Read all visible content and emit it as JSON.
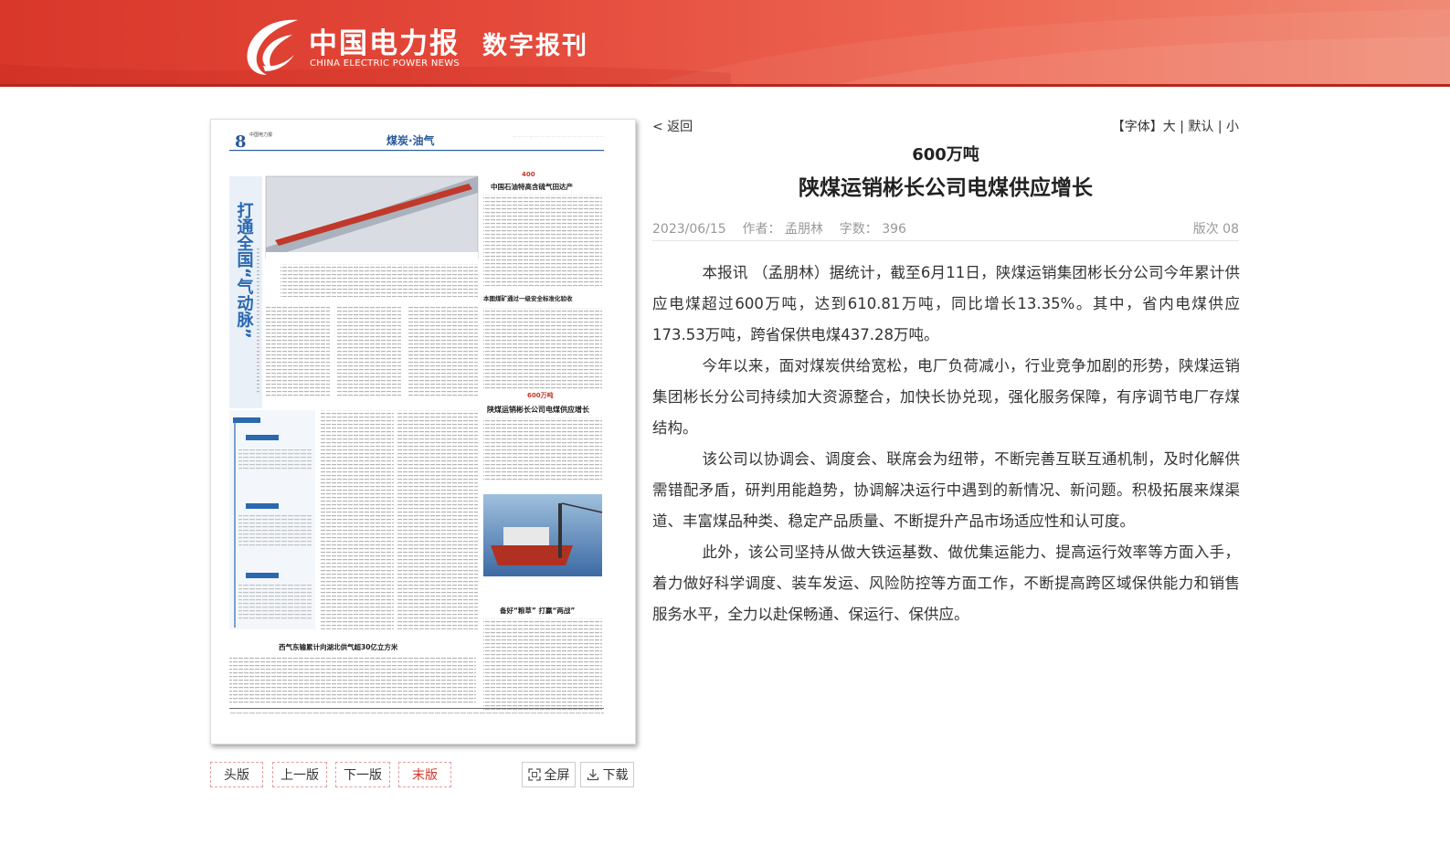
{
  "header": {
    "logo_cn": "中国电力报",
    "logo_en": "CHINA ELECTRIC POWER NEWS",
    "section": "数字报刊"
  },
  "paper_page": {
    "page_no": "8",
    "page_head": "中国电力报",
    "section_title": "煤炭·油气",
    "headline_vertical": "打通全国“气动脉”",
    "story_600_head": "600万吨",
    "story_600_title": "陕煤运销彬长公司电煤供应增长",
    "story_400_title": "中国石油特高含硫气田达产",
    "story_mine_title": "本图煤矿通过一级安全标准化验收",
    "story_gas_title": "西气东输累计向湖北供气超30亿立方米",
    "story_ship_title": "备好“粮草” 打赢“两战”"
  },
  "page_buttons": {
    "first": "头版",
    "prev": "上一版",
    "next": "下一版",
    "last": "末版",
    "fullscreen": "全屏",
    "download": "下载"
  },
  "nav": {
    "back": "< 返回",
    "font_label": "【字体】",
    "font_large": "大",
    "font_default": "默认",
    "font_small": "小"
  },
  "article": {
    "subtitle": "600万吨",
    "title": "陕煤运销彬长公司电煤供应增长",
    "date": "2023/06/15",
    "author_label": "作者：",
    "author": "孟朋林",
    "wordcount_label": "字数：",
    "wordcount": "396",
    "edition": "版次 08",
    "paragraphs": [
      "本报讯 （孟朋林）据统计，截至6月11日，陕煤运销集团彬长分公司今年累计供应电煤超过600万吨，达到610.81万吨，同比增长13.35%。其中，省内电煤供应173.53万吨，跨省保供电煤437.28万吨。",
      "今年以来，面对煤炭供给宽松，电厂负荷减小，行业竞争加剧的形势，陕煤运销集团彬长分公司持续加大资源整合，加快长协兑现，强化服务保障，有序调节电厂存煤结构。",
      "该公司以协调会、调度会、联席会为纽带，不断完善互联互通机制，及时化解供需错配矛盾，研判用能趋势，协调解决运行中遇到的新情况、新问题。积极拓展来煤渠道、丰富煤品种类、稳定产品质量、不断提升产品市场适应性和认可度。",
      "此外，该公司坚持从做大铁运基数、做优集运能力、提高运行效率等方面入手，着力做好科学调度、装车发运、风险防控等方面工作，不断提高跨区域保供能力和销售服务水平，全力以赴保畅通、保运行、保供应。"
    ]
  },
  "colors": {
    "brand_red": "#d8372a",
    "text": "#333333",
    "meta": "#999999"
  }
}
